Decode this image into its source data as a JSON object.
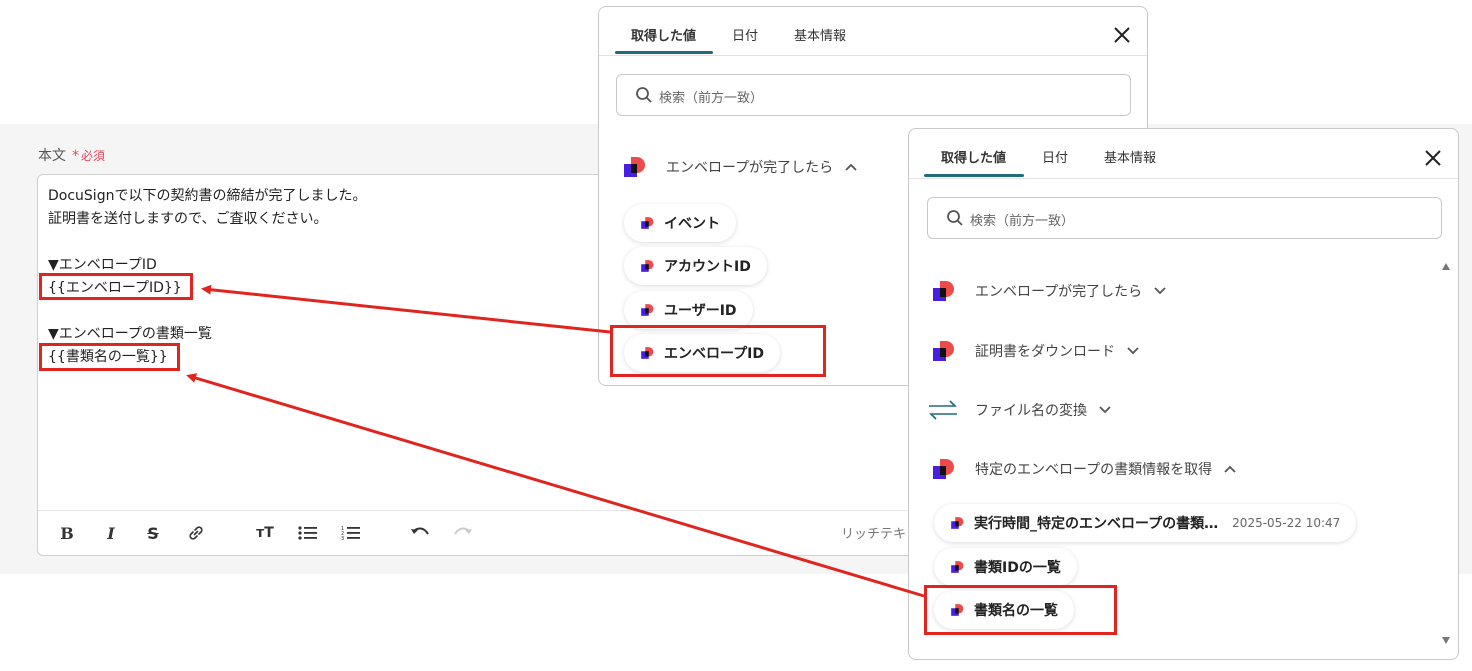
{
  "editor": {
    "label": "本文",
    "required_mark": "*",
    "required_text": "必須",
    "lines": [
      "DocuSignで以下の契約書の締結が完了しました。",
      "証明書を送付しますので、ご査収ください。",
      "▼エンベロープID",
      "{{エンベロープID}}",
      "▼エンベロープの書類一覧",
      "{{書類名の一覧}}"
    ],
    "rich_text_label": "リッチテキ"
  },
  "panel_back": {
    "tabs": [
      "取得した値",
      "日付",
      "基本情報"
    ],
    "search_placeholder": "検索（前方一致）",
    "group_title": "エンベロープが完了したら",
    "chips": [
      "イベント",
      "アカウントID",
      "ユーザーID",
      "エンベロープID"
    ]
  },
  "panel_front": {
    "tabs": [
      "取得した値",
      "日付",
      "基本情報"
    ],
    "search_placeholder": "検索（前方一致）",
    "groups": [
      "エンベロープが完了したら",
      "証明書をダウンロード",
      "ファイル名の変換",
      "特定のエンベロープの書類情報を取得"
    ],
    "chips": [
      {
        "label": "実行時間_特定のエンベロープの書類…",
        "value": "2025-05-22 10:47"
      },
      {
        "label": "書類IDの一覧",
        "value": ""
      },
      {
        "label": "書類名の一覧",
        "value": ""
      }
    ]
  },
  "colors": {
    "accent_tab": "#1d6d7a",
    "highlight_red": "#e0241f",
    "logo_red": "#ef4a4a",
    "logo_purple": "#4a1ee0"
  }
}
